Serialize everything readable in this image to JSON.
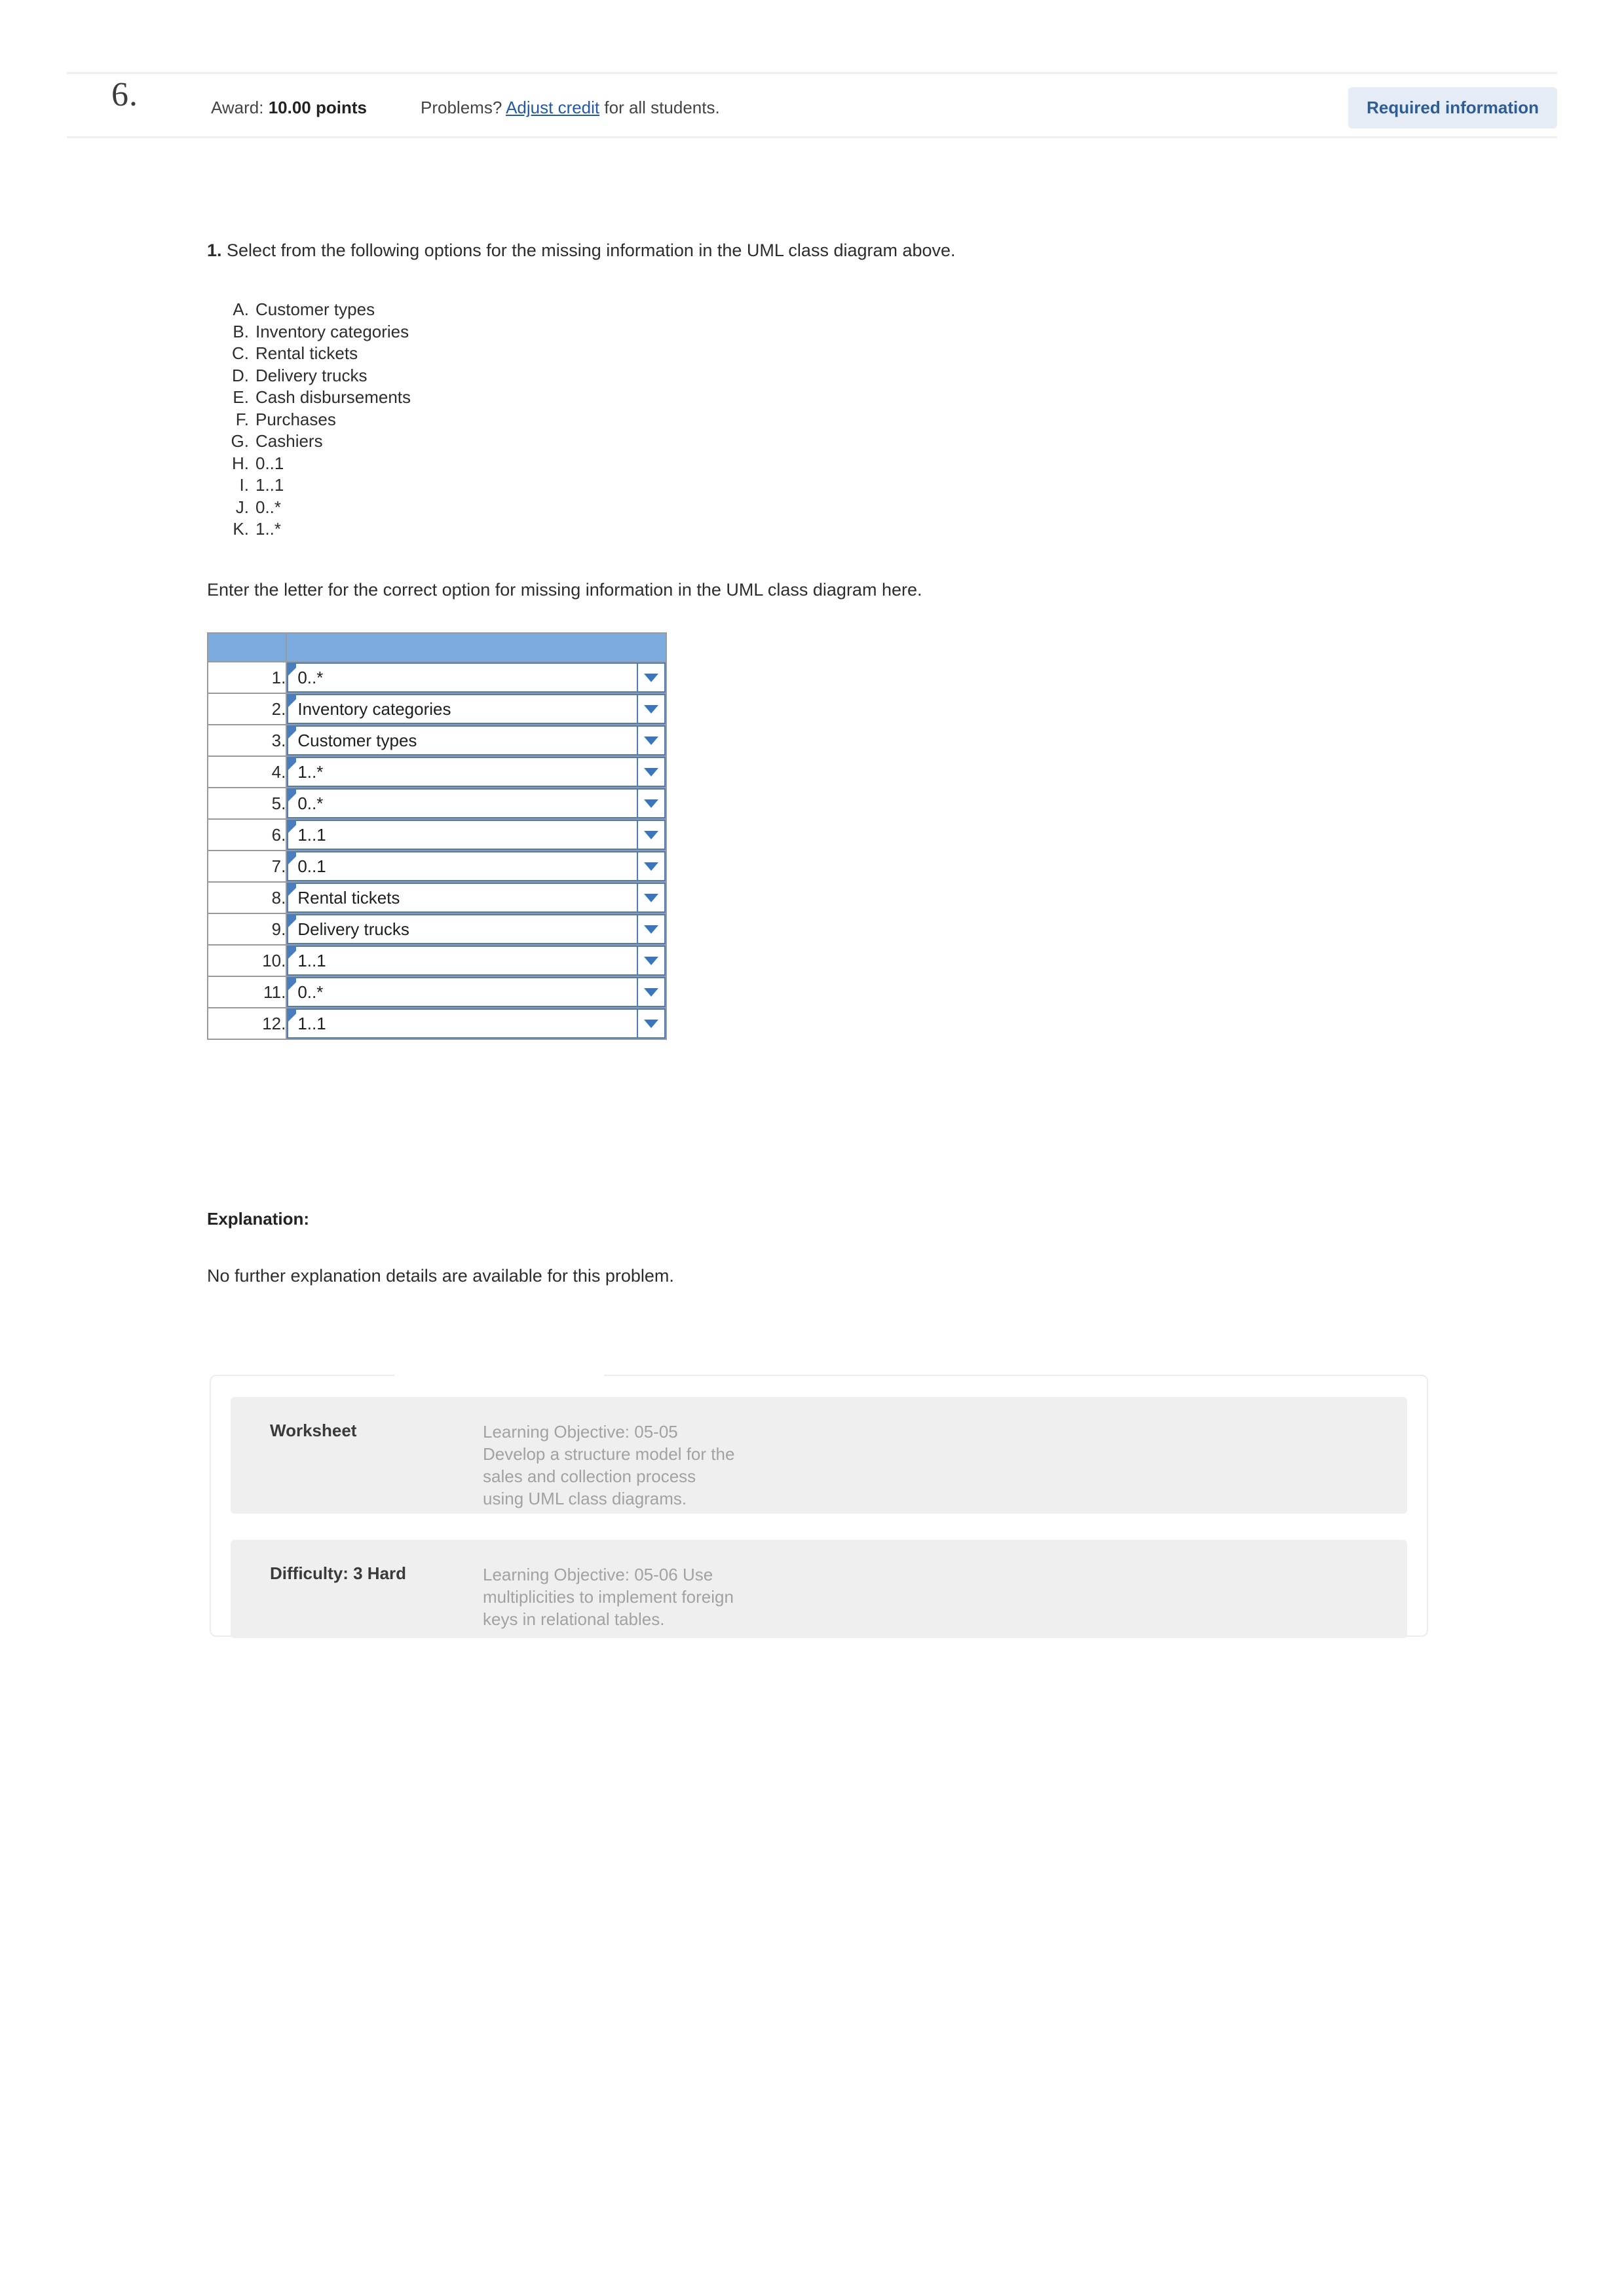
{
  "header": {
    "question_number": "6.",
    "award_prefix": "Award: ",
    "award_value": "10.00 points",
    "problems_prefix": "Problems? ",
    "adjust_credit_link": "Adjust credit",
    "problems_suffix": " for all students.",
    "required_badge": "Required information",
    "badge_bg": "#e5ecf6",
    "badge_fg": "#2d5d94",
    "link_color": "#2358a8"
  },
  "question": {
    "number": "1.",
    "prompt": " Select from the following options for the missing information in the UML class diagram above.",
    "options": [
      {
        "letter": "A.",
        "text": "Customer types"
      },
      {
        "letter": "B.",
        "text": "Inventory categories"
      },
      {
        "letter": "C.",
        "text": "Rental tickets"
      },
      {
        "letter": "D.",
        "text": "Delivery trucks"
      },
      {
        "letter": "E.",
        "text": "Cash disbursements"
      },
      {
        "letter": "F.",
        "text": "Purchases"
      },
      {
        "letter": "G.",
        "text": "Cashiers"
      },
      {
        "letter": "H.",
        "text": "0..1"
      },
      {
        "letter": "I.",
        "text": "1..1"
      },
      {
        "letter": "J.",
        "text": "0..*"
      },
      {
        "letter": "K.",
        "text": "1..*"
      }
    ],
    "enter_instruction": "Enter the letter for the correct option for missing information in the UML class diagram here."
  },
  "answer_table": {
    "header_bg": "#7cabdf",
    "header_cells": [
      "",
      ""
    ],
    "rows": [
      {
        "num": "1.",
        "value": "0..*"
      },
      {
        "num": "2.",
        "value": "Inventory categories"
      },
      {
        "num": "3.",
        "value": "Customer types"
      },
      {
        "num": "4.",
        "value": "1..*"
      },
      {
        "num": "5.",
        "value": "0..*"
      },
      {
        "num": "6.",
        "value": "1..1"
      },
      {
        "num": "7.",
        "value": "0..1"
      },
      {
        "num": "8.",
        "value": "Rental tickets"
      },
      {
        "num": "9.",
        "value": "Delivery trucks"
      },
      {
        "num": "10.",
        "value": "1..1"
      },
      {
        "num": "11.",
        "value": "0..*"
      },
      {
        "num": "12.",
        "value": "1..1"
      }
    ]
  },
  "explanation": {
    "label": "Explanation:",
    "text": "No further explanation details are available for this problem."
  },
  "footer": {
    "rows": [
      {
        "label": "Worksheet",
        "value": "Learning Objective: 05-05\nDevelop a structure model for the\nsales and collection process\nusing UML class diagrams."
      },
      {
        "label": "Difficulty: 3 Hard",
        "value": "Learning Objective: 05-06 Use\nmultiplicities to implement foreign\nkeys in relational tables."
      }
    ]
  }
}
